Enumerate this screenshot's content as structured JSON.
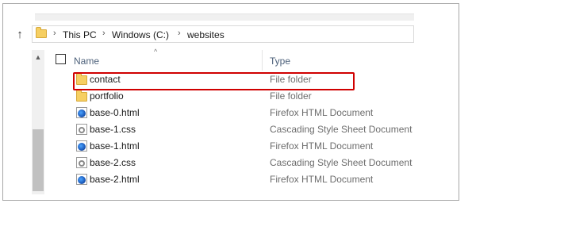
{
  "address": {
    "breadcrumbs": [
      "This PC",
      "Windows (C:)",
      "websites"
    ]
  },
  "columns": {
    "name": "Name",
    "type": "Type"
  },
  "files": [
    {
      "name": "contact",
      "type": "File folder",
      "icon": "folder-icon"
    },
    {
      "name": "portfolio",
      "type": "File folder",
      "icon": "folder-icon"
    },
    {
      "name": "base-0.html",
      "type": "Firefox HTML Document",
      "icon": "firefox-html-icon"
    },
    {
      "name": "base-1.css",
      "type": "Cascading Style Sheet Document",
      "icon": "css-file-icon"
    },
    {
      "name": "base-1.html",
      "type": "Firefox HTML Document",
      "icon": "firefox-html-icon"
    },
    {
      "name": "base-2.css",
      "type": "Cascading Style Sheet Document",
      "icon": "css-file-icon"
    },
    {
      "name": "base-2.html",
      "type": "Firefox HTML Document",
      "icon": "firefox-html-icon"
    }
  ],
  "highlight": {
    "target": "contact",
    "color": "#d00000"
  }
}
